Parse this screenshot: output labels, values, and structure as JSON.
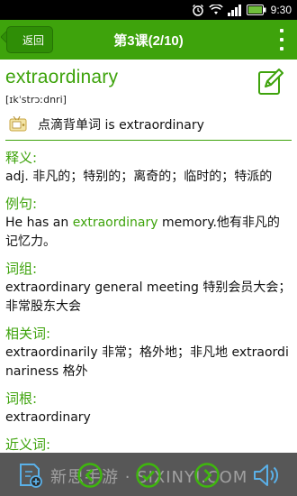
{
  "status": {
    "time": "9:30"
  },
  "appbar": {
    "back_label": "返回",
    "title": "第3课(2/10)"
  },
  "entry": {
    "word": "extraordinary",
    "phonetic": "[ɪkˈstrɔːdnri]",
    "sentence_prefix": "点滴背单词 is ",
    "sentence_word": "extraordinary"
  },
  "sections": {
    "definition": {
      "heading": "释义:",
      "body": "adj. 非凡的；特别的；离奇的；临时的；特派的"
    },
    "example": {
      "heading": "例句:",
      "before": "He has an ",
      "word": "extraordinary",
      "after": " memory.他有非凡的记忆力。"
    },
    "phrases": {
      "heading": "词组:",
      "body": "extraordinary general meeting 特别会员大会；非常股东大会"
    },
    "related": {
      "heading": "相关词:",
      "body": "extraordinarily 非常；格外地；非凡地 extraordinariness 格外"
    },
    "root": {
      "heading": "词根:",
      "body": "extraordinary"
    },
    "synonyms": {
      "heading": "近义词:"
    }
  },
  "bottom": {
    "watermark": "新思手游 · SIXINYI.COM"
  },
  "colors": {
    "accent": "#3ea30c",
    "statusbar": "#000000"
  },
  "icons": [
    "alarm-icon",
    "wifi-icon",
    "signal-icon",
    "battery-icon",
    "overflow-menu-icon",
    "edit-icon",
    "speaker-icon",
    "add-note-icon",
    "prev-icon",
    "ok-icon",
    "next-icon",
    "sound-icon"
  ]
}
